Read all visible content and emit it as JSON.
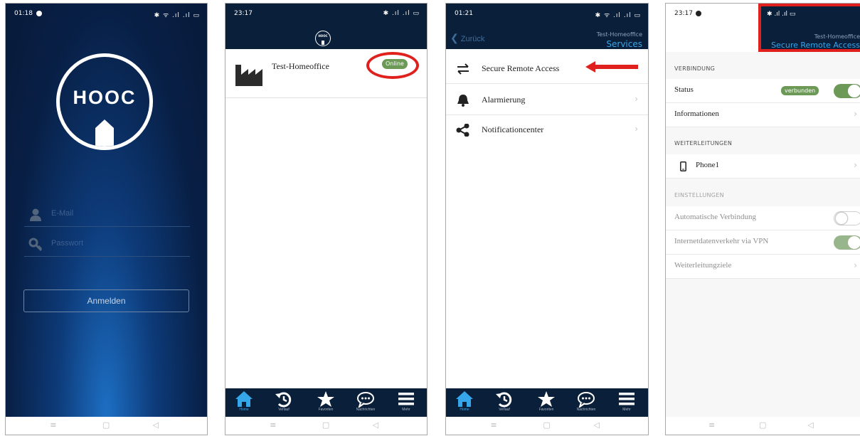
{
  "colors": {
    "header_bg": "#0a1f3a",
    "accent_blue": "#36a6ea",
    "online_green": "#6c9a56",
    "highlight_red": "#e0201c"
  },
  "nav_icons": [
    "menu-icon",
    "square-icon",
    "back-triangle-icon"
  ],
  "phone1": {
    "time": "01:18",
    "status_icons": "✱ ᯤ .ıl .ıl ▭",
    "logo_text": "HOOC",
    "email_placeholder": "E-Mail",
    "password_placeholder": "Passwort",
    "login_label": "Anmelden"
  },
  "phone2": {
    "time": "23:17",
    "status_icons": "✱ .ıl .ıl ▭",
    "header_logo": "HOOC",
    "site_name": "Test-Homeoffice",
    "status_badge": "Online",
    "tabs": [
      {
        "label": "Home",
        "icon": "home-icon"
      },
      {
        "label": "Verlauf",
        "icon": "history-icon"
      },
      {
        "label": "Favoriten",
        "icon": "star-icon"
      },
      {
        "label": "Nachrichten",
        "icon": "chat-icon"
      },
      {
        "label": "Mehr",
        "icon": "hamburger-icon"
      }
    ]
  },
  "phone3": {
    "time": "01:21",
    "status_icons": "✱ ᯤ .ıl .ıl ▭",
    "back_label": "Zurück",
    "header_sub": "Test-Homeoffice",
    "header_title": "Services",
    "items": [
      {
        "label": "Secure Remote Access",
        "icon": "swap-arrows-icon"
      },
      {
        "label": "Alarmierung",
        "icon": "bell-icon"
      },
      {
        "label": "Notificationcenter",
        "icon": "share-icon"
      }
    ],
    "tabs": [
      {
        "label": "Home"
      },
      {
        "label": "Verlauf"
      },
      {
        "label": "Favoriten"
      },
      {
        "label": "Nachrichten"
      },
      {
        "label": "Mehr"
      }
    ]
  },
  "phone4": {
    "time": "23:17",
    "status_icons": "✱ .ıl .ıl ▭",
    "header_sub": "Test-Homeoffice",
    "header_title": "Secure Remote Access",
    "section_connection": "VERBINDUNG",
    "status_label": "Status",
    "status_badge": "verbunden",
    "info_label": "Informationen",
    "section_forwarding": "WEITERLEITUNGEN",
    "phone_label": "Phone1",
    "section_settings": "EINSTELLUNGEN",
    "auto_connect_label": "Automatische Verbindung",
    "vpn_label": "Internetdatenverkehr via VPN",
    "targets_label": "Weiterleitungziele",
    "toggles": {
      "status": true,
      "auto_connect": false,
      "vpn": true
    }
  }
}
